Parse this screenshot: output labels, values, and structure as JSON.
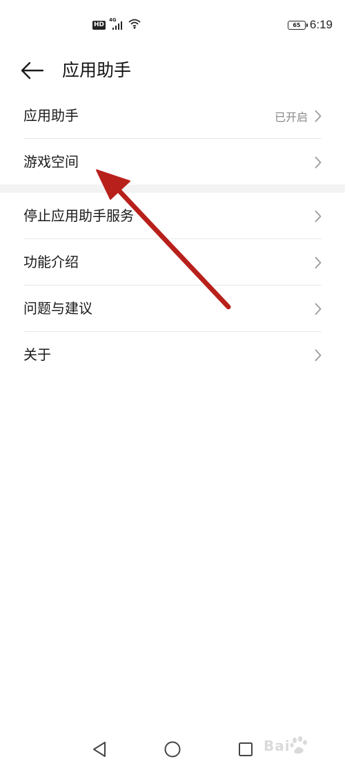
{
  "status_bar": {
    "hd": "HD",
    "network": "4G",
    "battery": "65",
    "time": "6:19"
  },
  "header": {
    "title": "应用助手",
    "back_icon": "arrow-left-icon"
  },
  "list_primary": [
    {
      "label": "应用助手",
      "status": "已开启"
    },
    {
      "label": "游戏空间",
      "status": ""
    }
  ],
  "list_secondary": [
    {
      "label": "停止应用助手服务"
    },
    {
      "label": "功能介绍"
    },
    {
      "label": "问题与建议"
    },
    {
      "label": "关于"
    }
  ],
  "nav_bar": {
    "back_icon": "triangle-back-icon",
    "home_icon": "circle-home-icon",
    "recent_icon": "square-recent-icon"
  },
  "watermark": "Bai",
  "colors": {
    "annotation_arrow": "#b8201b",
    "divider": "#e7e7e7",
    "section_gap": "#f3f3f3",
    "secondary_text": "#888888"
  }
}
